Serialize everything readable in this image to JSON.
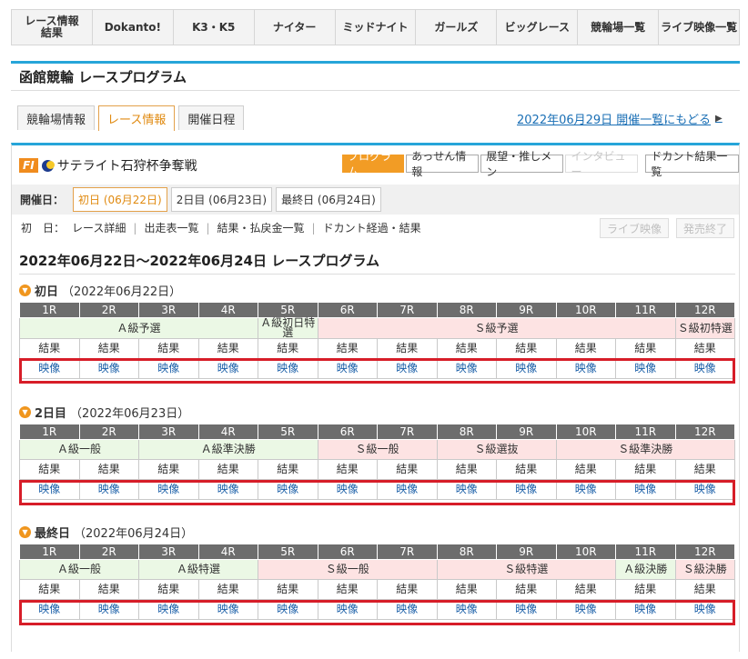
{
  "topnav": [
    "レース情報\n結果",
    "Dokanto!",
    "K3・K5",
    "ナイター",
    "ミッドナイト",
    "ガールズ",
    "ビッグレース",
    "競輪場一覧",
    "ライブ映像一覧"
  ],
  "page_title": "函館競輪 レースプログラム",
  "tabs": [
    "競輪場情報",
    "レース情報",
    "開催日程"
  ],
  "back_link": "2022年06月29日 開催一覧にもどる",
  "race": {
    "grade": "FI",
    "name": "サテライト石狩杯争奪戦"
  },
  "actions": [
    "プログラム",
    "あっせん情報",
    "展望・推しメン",
    "インタビュー",
    "ドカント結果一覧"
  ],
  "day_label": "開催日：",
  "day_buttons": [
    "初日 (06月22日)",
    "2日目 (06月23日)",
    "最終日 (06月24日)"
  ],
  "link_row": {
    "label": "初　日：",
    "links": [
      "レース詳細",
      "出走表一覧",
      "結果・払戻金一覧",
      "ドカント経過・結果"
    ]
  },
  "disabled_buttons": [
    "ライブ映像",
    "発売終了"
  ],
  "main_heading": "2022年06月22日～2022年06月24日 レースプログラム",
  "race_numbers": [
    "1R",
    "2R",
    "3R",
    "4R",
    "5R",
    "6R",
    "7R",
    "8R",
    "9R",
    "10R",
    "11R",
    "12R"
  ],
  "result_label": "結果",
  "video_label": "映像",
  "days": [
    {
      "title": "初日",
      "date": "（2022年06月22日）",
      "classes": [
        {
          "label": "Ａ級予選",
          "span": 4,
          "cls": "A"
        },
        {
          "label": "Ａ級初日特選",
          "span": 1,
          "cls": "A"
        },
        {
          "label": "Ｓ級予選",
          "span": 6,
          "cls": "S"
        },
        {
          "label": "Ｓ級初特選",
          "span": 1,
          "cls": "S"
        }
      ]
    },
    {
      "title": "2日目",
      "date": "（2022年06月23日）",
      "classes": [
        {
          "label": "Ａ級一般",
          "span": 2,
          "cls": "A"
        },
        {
          "label": "Ａ級準決勝",
          "span": 3,
          "cls": "A"
        },
        {
          "label": "Ｓ級一般",
          "span": 2,
          "cls": "S"
        },
        {
          "label": "Ｓ級選抜",
          "span": 2,
          "cls": "S"
        },
        {
          "label": "Ｓ級準決勝",
          "span": 3,
          "cls": "S"
        }
      ]
    },
    {
      "title": "最終日",
      "date": "（2022年06月24日）",
      "classes": [
        {
          "label": "Ａ級一般",
          "span": 2,
          "cls": "A"
        },
        {
          "label": "Ａ級特選",
          "span": 2,
          "cls": "A"
        },
        {
          "label": "Ｓ級一般",
          "span": 3,
          "cls": "S"
        },
        {
          "label": "Ｓ級特選",
          "span": 3,
          "cls": "S"
        },
        {
          "label": "Ａ級決勝",
          "span": 1,
          "cls": "A"
        },
        {
          "label": "Ｓ級決勝",
          "span": 1,
          "cls": "S"
        }
      ]
    }
  ],
  "colors": {
    "accent_blue": "#26a5d9",
    "orange": "#f29c25",
    "header_grey": "#6d6d6d",
    "a_class_bg": "#ebf8e5",
    "s_class_bg": "#fde3e3",
    "highlight_red": "#d71d28",
    "link_blue": "#1a6fb5"
  }
}
